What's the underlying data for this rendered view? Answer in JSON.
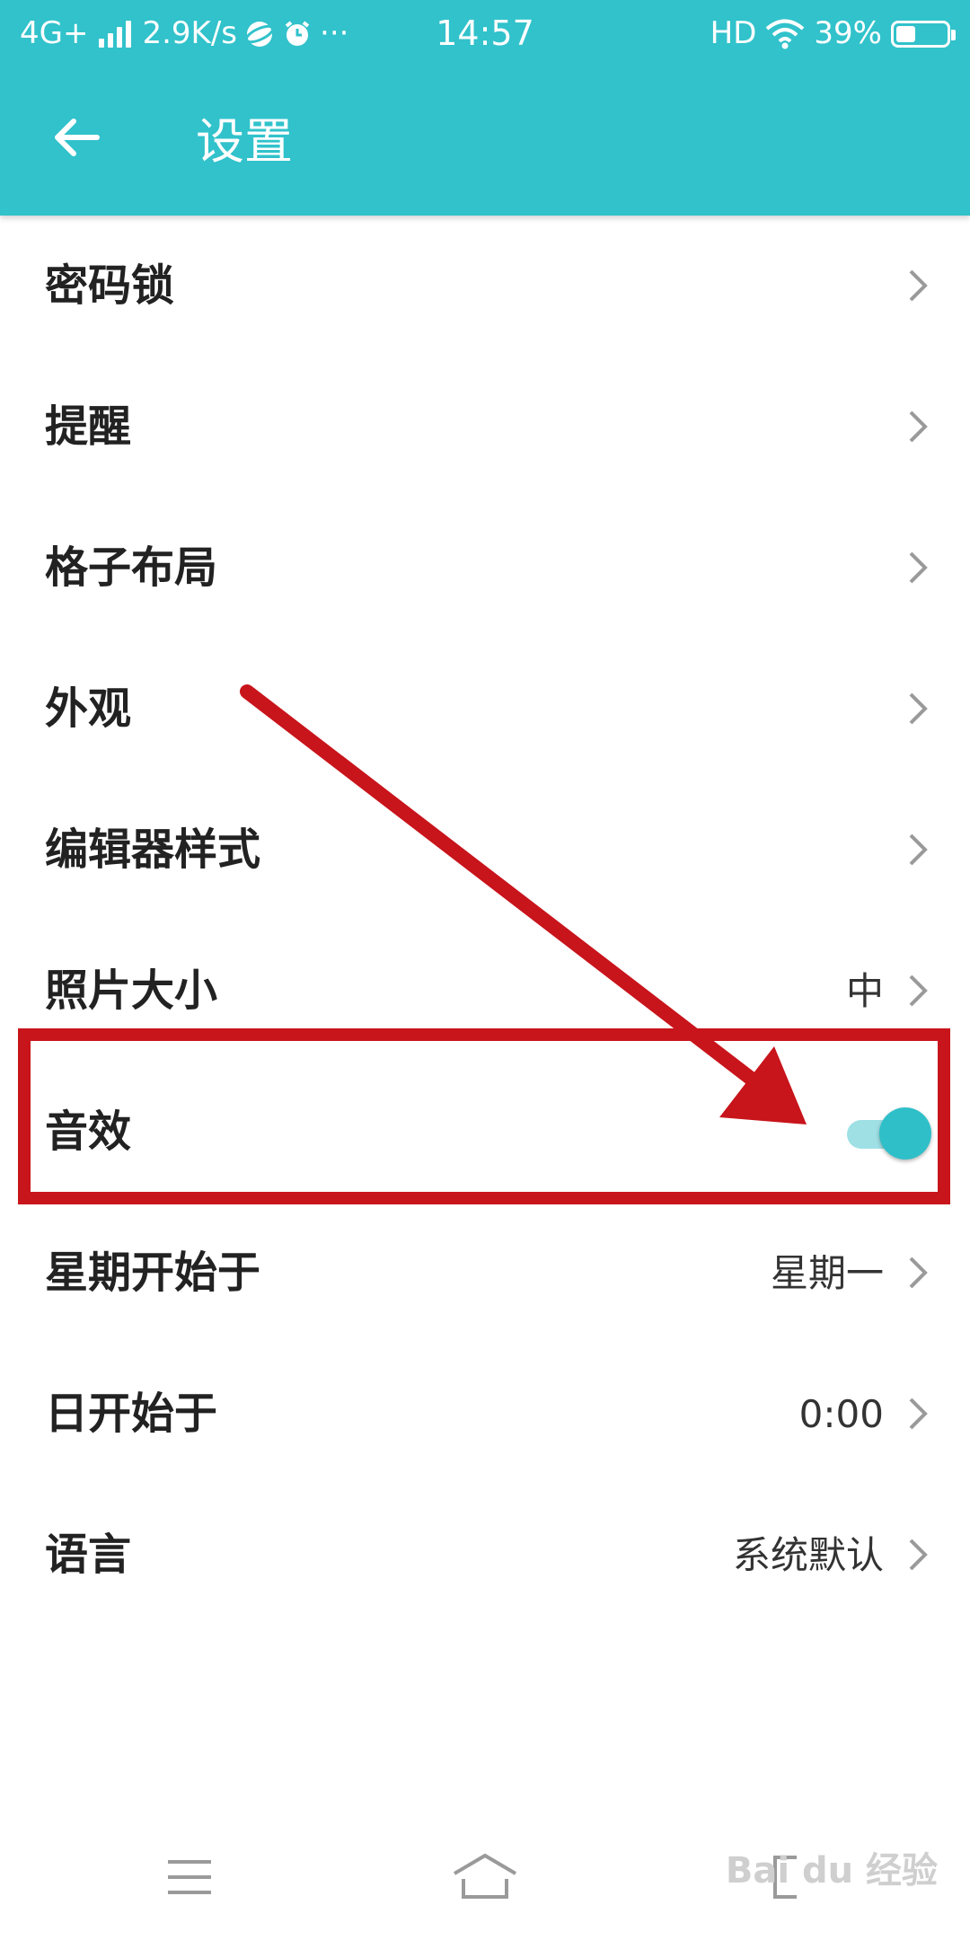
{
  "status_bar": {
    "network": "4G+",
    "speed": "2.9K/s",
    "more": "···",
    "time": "14:57",
    "hd": "HD",
    "battery": "39%",
    "battery_level": 0.39
  },
  "app_bar": {
    "title": "设置"
  },
  "settings": [
    {
      "label": "密码锁",
      "value": ""
    },
    {
      "label": "提醒",
      "value": ""
    },
    {
      "label": "格子布局",
      "value": ""
    },
    {
      "label": "外观",
      "value": ""
    },
    {
      "label": "编辑器样式",
      "value": ""
    },
    {
      "label": "照片大小",
      "value": "中"
    },
    {
      "label": "音效",
      "toggle_on": true
    },
    {
      "label": "星期开始于",
      "value": "星期一"
    },
    {
      "label": "日开始于",
      "value": "0:00"
    },
    {
      "label": "语言",
      "value": "系统默认"
    }
  ],
  "watermark": "Bai du 经验",
  "colors": {
    "header": "#31c2cb",
    "accent": "#2fbfc9",
    "annotation_red": "#c8141b"
  }
}
